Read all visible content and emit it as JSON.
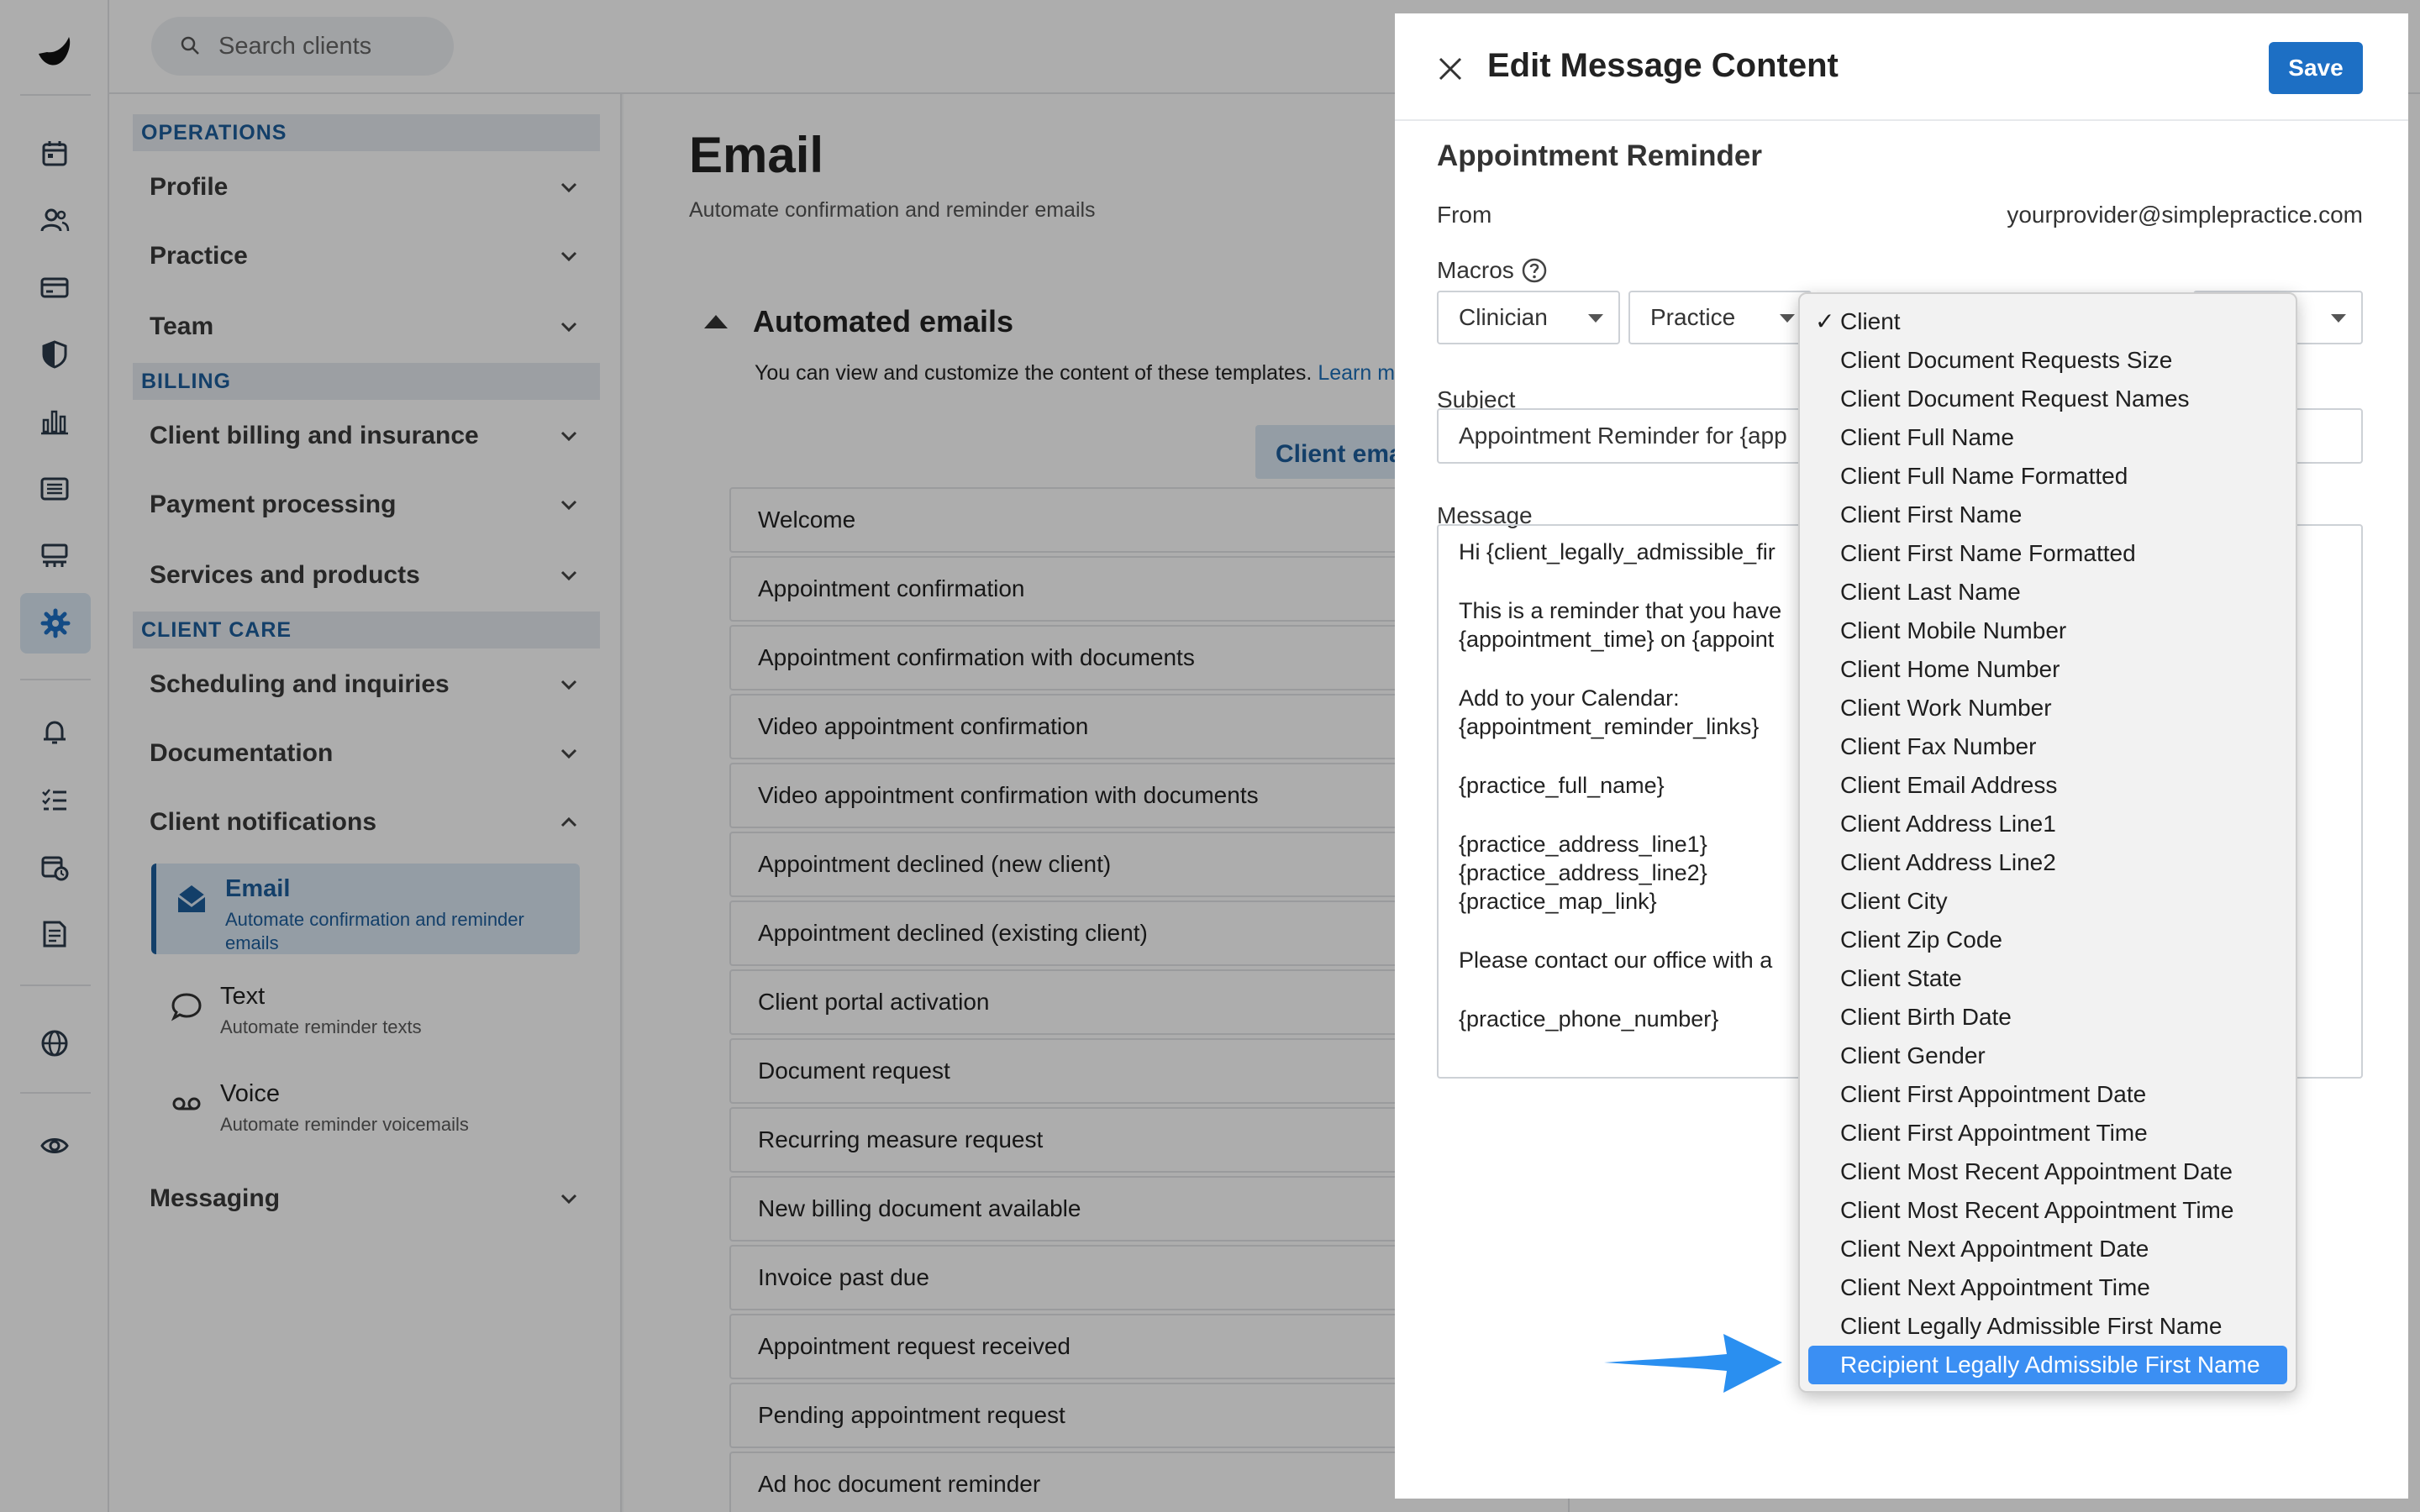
{
  "search": {
    "placeholder": "Search clients"
  },
  "nav": {
    "operations_label": "OPERATIONS",
    "billing_label": "BILLING",
    "client_care_label": "CLIENT CARE",
    "profile": "Profile",
    "practice": "Practice",
    "team": "Team",
    "client_billing": "Client billing and insurance",
    "payment_processing": "Payment processing",
    "services_products": "Services and products",
    "scheduling": "Scheduling and inquiries",
    "documentation": "Documentation",
    "client_notifications": "Client notifications",
    "email_title": "Email",
    "email_desc": "Automate confirmation and reminder emails",
    "text_title": "Text",
    "text_desc": "Automate reminder texts",
    "voice_title": "Voice",
    "voice_desc": "Automate reminder voicemails",
    "messaging": "Messaging"
  },
  "main": {
    "title": "Email",
    "subtitle": "Automate confirmation and reminder emails",
    "automated_heading": "Automated emails",
    "automated_desc": "You can view and customize the content of these templates.",
    "learn_link": "Learn m",
    "client_tab": "Client ema",
    "templates": [
      "Welcome",
      "Appointment confirmation",
      "Appointment confirmation with documents",
      "Video appointment confirmation",
      "Video appointment confirmation with documents",
      "Appointment declined (new client)",
      "Appointment declined (existing client)",
      "Client portal activation",
      "Document request",
      "Recurring measure request",
      "New billing document available",
      "Invoice past due",
      "Appointment request received",
      "Pending appointment request",
      "Ad hoc document reminder"
    ]
  },
  "drawer": {
    "title": "Edit Message Content",
    "save_label": "Save",
    "template_name": "Appointment Reminder",
    "from_label": "From",
    "from_value": "yourprovider@simplepractice.com",
    "macros_label": "Macros",
    "macro_clinician": "Clinician",
    "macro_practice": "Practice",
    "subject_label": "Subject",
    "subject_value": "Appointment Reminder for {app",
    "message_label": "Message",
    "message_lines": [
      "Hi {client_legally_admissible_fir",
      "",
      "This is a reminder that you have",
      "{appointment_time} on {appoint",
      "",
      "Add to your Calendar:",
      "{appointment_reminder_links}",
      "",
      "{practice_full_name}",
      "",
      "{practice_address_line1}",
      "{practice_address_line2}",
      "{practice_map_link}",
      "",
      "Please contact our office with a",
      "",
      "{practice_phone_number}"
    ]
  },
  "dropdown": {
    "check_mark": "✓",
    "options": [
      "Client",
      "Client Document Requests Size",
      "Client Document Request Names",
      "Client Full Name",
      "Client Full Name Formatted",
      "Client First Name",
      "Client First Name Formatted",
      "Client Last Name",
      "Client Mobile Number",
      "Client Home Number",
      "Client Work Number",
      "Client Fax Number",
      "Client Email Address",
      "Client Address Line1",
      "Client Address Line2",
      "Client City",
      "Client Zip Code",
      "Client State",
      "Client Birth Date",
      "Client Gender",
      "Client First Appointment Date",
      "Client First Appointment Time",
      "Client Most Recent Appointment Date",
      "Client Most Recent Appointment Time",
      "Client Next Appointment Date",
      "Client Next Appointment Time",
      "Client Legally Admissible First Name",
      "Recipient Legally Admissible First Name"
    ],
    "highlight_color": "#3b8ff3"
  },
  "colors": {
    "accent": "#1d6fc4",
    "nav_accent": "#1d5d9b",
    "arrow": "#2a8ff0"
  }
}
